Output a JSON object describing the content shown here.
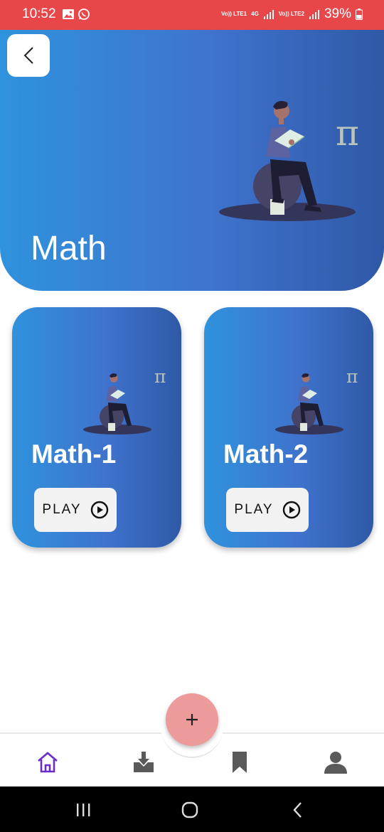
{
  "status_bar": {
    "time": "10:52",
    "battery": "39%",
    "sim1": "Vo)) LTE1",
    "sim2": "Vo)) LTE2",
    "net": "4G"
  },
  "header": {
    "title": "Math",
    "back_icon": "chevron-left-icon",
    "pi_symbol": "π"
  },
  "cards": [
    {
      "title": "Math-1",
      "play_label": "PLAY",
      "pi_symbol": "π"
    },
    {
      "title": "Math-2",
      "play_label": "PLAY",
      "pi_symbol": "π"
    }
  ],
  "fab": {
    "icon": "plus-icon",
    "symbol": "+"
  },
  "bottom_nav": [
    {
      "icon": "home-icon",
      "active": true
    },
    {
      "icon": "download-tray-icon",
      "active": false
    },
    {
      "icon": "bookmark-icon",
      "active": false
    },
    {
      "icon": "profile-icon",
      "active": false
    }
  ],
  "colors": {
    "status_bar": "#e8474a",
    "gradient_start": "#2f92dd",
    "gradient_end": "#2f59a7",
    "fab": "#ec9b9a",
    "active_nav": "#6a2dc8",
    "inactive_nav": "#5a5a5a"
  }
}
